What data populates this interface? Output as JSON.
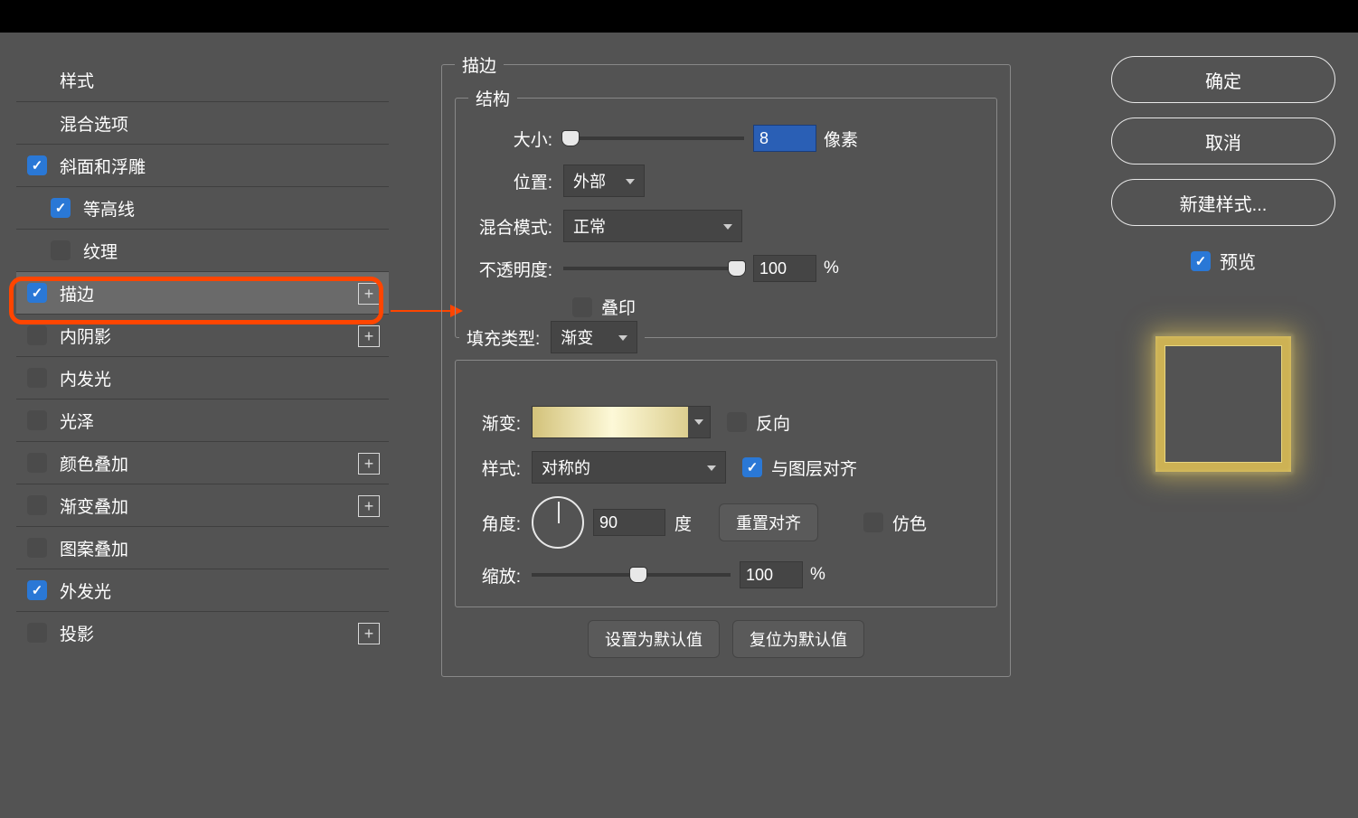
{
  "top": {},
  "styles": {
    "header": "样式",
    "blending": "混合选项",
    "bevel": "斜面和浮雕",
    "contour": "等高线",
    "texture": "纹理",
    "stroke": "描边",
    "inner_shadow": "内阴影",
    "inner_glow": "内发光",
    "satin": "光泽",
    "color_overlay": "颜色叠加",
    "gradient_overlay": "渐变叠加",
    "pattern_overlay": "图案叠加",
    "outer_glow": "外发光",
    "drop_shadow": "投影"
  },
  "stroke_panel": {
    "title": "描边",
    "structure": "结构",
    "size_label": "大小:",
    "size_value": "8",
    "size_unit": "像素",
    "position_label": "位置:",
    "position_value": "外部",
    "blend_mode_label": "混合模式:",
    "blend_mode_value": "正常",
    "opacity_label": "不透明度:",
    "opacity_value": "100",
    "opacity_unit": "%",
    "overprint": "叠印",
    "fill_type_label": "填充类型:",
    "fill_type_value": "渐变",
    "gradient_label": "渐变:",
    "reverse": "反向",
    "style_label": "样式:",
    "style_value": "对称的",
    "align_layer": "与图层对齐",
    "angle_label": "角度:",
    "angle_value": "90",
    "angle_unit": "度",
    "reset_align": "重置对齐",
    "dither": "仿色",
    "scale_label": "缩放:",
    "scale_value": "100",
    "scale_unit": "%",
    "set_default": "设置为默认值",
    "reset_default": "复位为默认值"
  },
  "right": {
    "ok": "确定",
    "cancel": "取消",
    "new_style": "新建样式...",
    "preview": "预览"
  }
}
